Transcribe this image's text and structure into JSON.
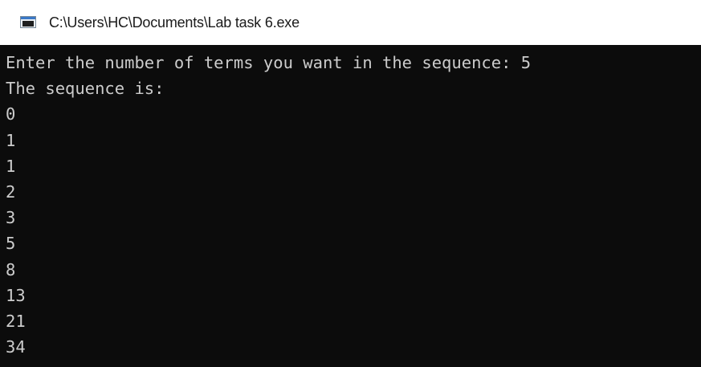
{
  "window": {
    "title": "C:\\Users\\HC\\Documents\\Lab task 6.exe",
    "icon": "console-app-icon"
  },
  "console": {
    "lines": [
      "Enter the number of terms you want in the sequence: 5",
      "The sequence is:",
      "0",
      "1",
      "1",
      "2",
      "3",
      "5",
      "8",
      "13",
      "21",
      "34"
    ],
    "background_color": "#0c0c0c",
    "text_color": "#cccccc"
  }
}
